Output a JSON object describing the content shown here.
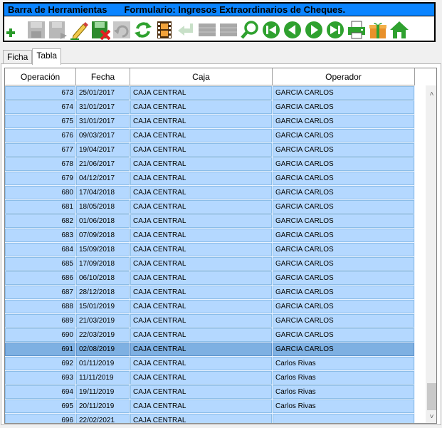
{
  "toolbar": {
    "title": "Barra de Herramientas",
    "form_title": "Formulario: Ingresos Extraordinarios de Cheques.",
    "icons": [
      "add-icon",
      "save-disabled-icon",
      "save-as-disabled-icon",
      "edit-icon",
      "delete-icon",
      "undo-disabled-icon",
      "refresh-icon",
      "film-icon",
      "back-arrow-disabled-icon",
      "grid-disabled-icon",
      "grid-disabled-icon",
      "search-icon",
      "first-record-icon",
      "previous-record-icon",
      "next-record-icon",
      "last-record-icon",
      "print-icon",
      "gift-icon",
      "home-icon"
    ]
  },
  "tabs": [
    {
      "label": "Ficha",
      "active": false
    },
    {
      "label": "Tabla",
      "active": true
    }
  ],
  "table": {
    "columns": [
      "Operación",
      "Fecha",
      "Caja",
      "Operador"
    ],
    "rows": [
      [
        "673",
        "25/01/2017",
        "CAJA CENTRAL",
        "GARCIA CARLOS"
      ],
      [
        "674",
        "31/01/2017",
        "CAJA CENTRAL",
        "GARCIA CARLOS"
      ],
      [
        "675",
        "31/01/2017",
        "CAJA CENTRAL",
        "GARCIA CARLOS"
      ],
      [
        "676",
        "09/03/2017",
        "CAJA CENTRAL",
        "GARCIA CARLOS"
      ],
      [
        "677",
        "19/04/2017",
        "CAJA CENTRAL",
        "GARCIA CARLOS"
      ],
      [
        "678",
        "21/06/2017",
        "CAJA CENTRAL",
        "GARCIA CARLOS"
      ],
      [
        "679",
        "04/12/2017",
        "CAJA CENTRAL",
        "GARCIA CARLOS"
      ],
      [
        "680",
        "17/04/2018",
        "CAJA CENTRAL",
        "GARCIA CARLOS"
      ],
      [
        "681",
        "18/05/2018",
        "CAJA CENTRAL",
        "GARCIA CARLOS"
      ],
      [
        "682",
        "01/06/2018",
        "CAJA CENTRAL",
        "GARCIA CARLOS"
      ],
      [
        "683",
        "07/09/2018",
        "CAJA CENTRAL",
        "GARCIA CARLOS"
      ],
      [
        "684",
        "15/09/2018",
        "CAJA CENTRAL",
        "GARCIA CARLOS"
      ],
      [
        "685",
        "17/09/2018",
        "CAJA CENTRAL",
        "GARCIA CARLOS"
      ],
      [
        "686",
        "06/10/2018",
        "CAJA CENTRAL",
        "GARCIA CARLOS"
      ],
      [
        "687",
        "28/12/2018",
        "CAJA CENTRAL",
        "GARCIA CARLOS"
      ],
      [
        "688",
        "15/01/2019",
        "CAJA CENTRAL",
        "GARCIA CARLOS"
      ],
      [
        "689",
        "21/03/2019",
        "CAJA CENTRAL",
        "GARCIA CARLOS"
      ],
      [
        "690",
        "22/03/2019",
        "CAJA CENTRAL",
        "GARCIA CARLOS"
      ],
      [
        "691",
        "02/08/2019",
        "CAJA CENTRAL",
        "GARCIA CARLOS"
      ],
      [
        "692",
        "01/11/2019",
        "CAJA CENTRAL",
        "Carlos Rivas"
      ],
      [
        "693",
        "11/11/2019",
        "CAJA CENTRAL",
        "Carlos Rivas"
      ],
      [
        "694",
        "19/11/2019",
        "CAJA CENTRAL",
        "Carlos Rivas"
      ],
      [
        "695",
        "20/11/2019",
        "CAJA CENTRAL",
        "Carlos Rivas"
      ],
      [
        "696",
        "22/02/2021",
        "CAJA CENTRAL",
        ""
      ]
    ],
    "selected_row": 18
  },
  "scrollbar": {
    "up_arrow": "˄",
    "down_arrow": "˅"
  }
}
